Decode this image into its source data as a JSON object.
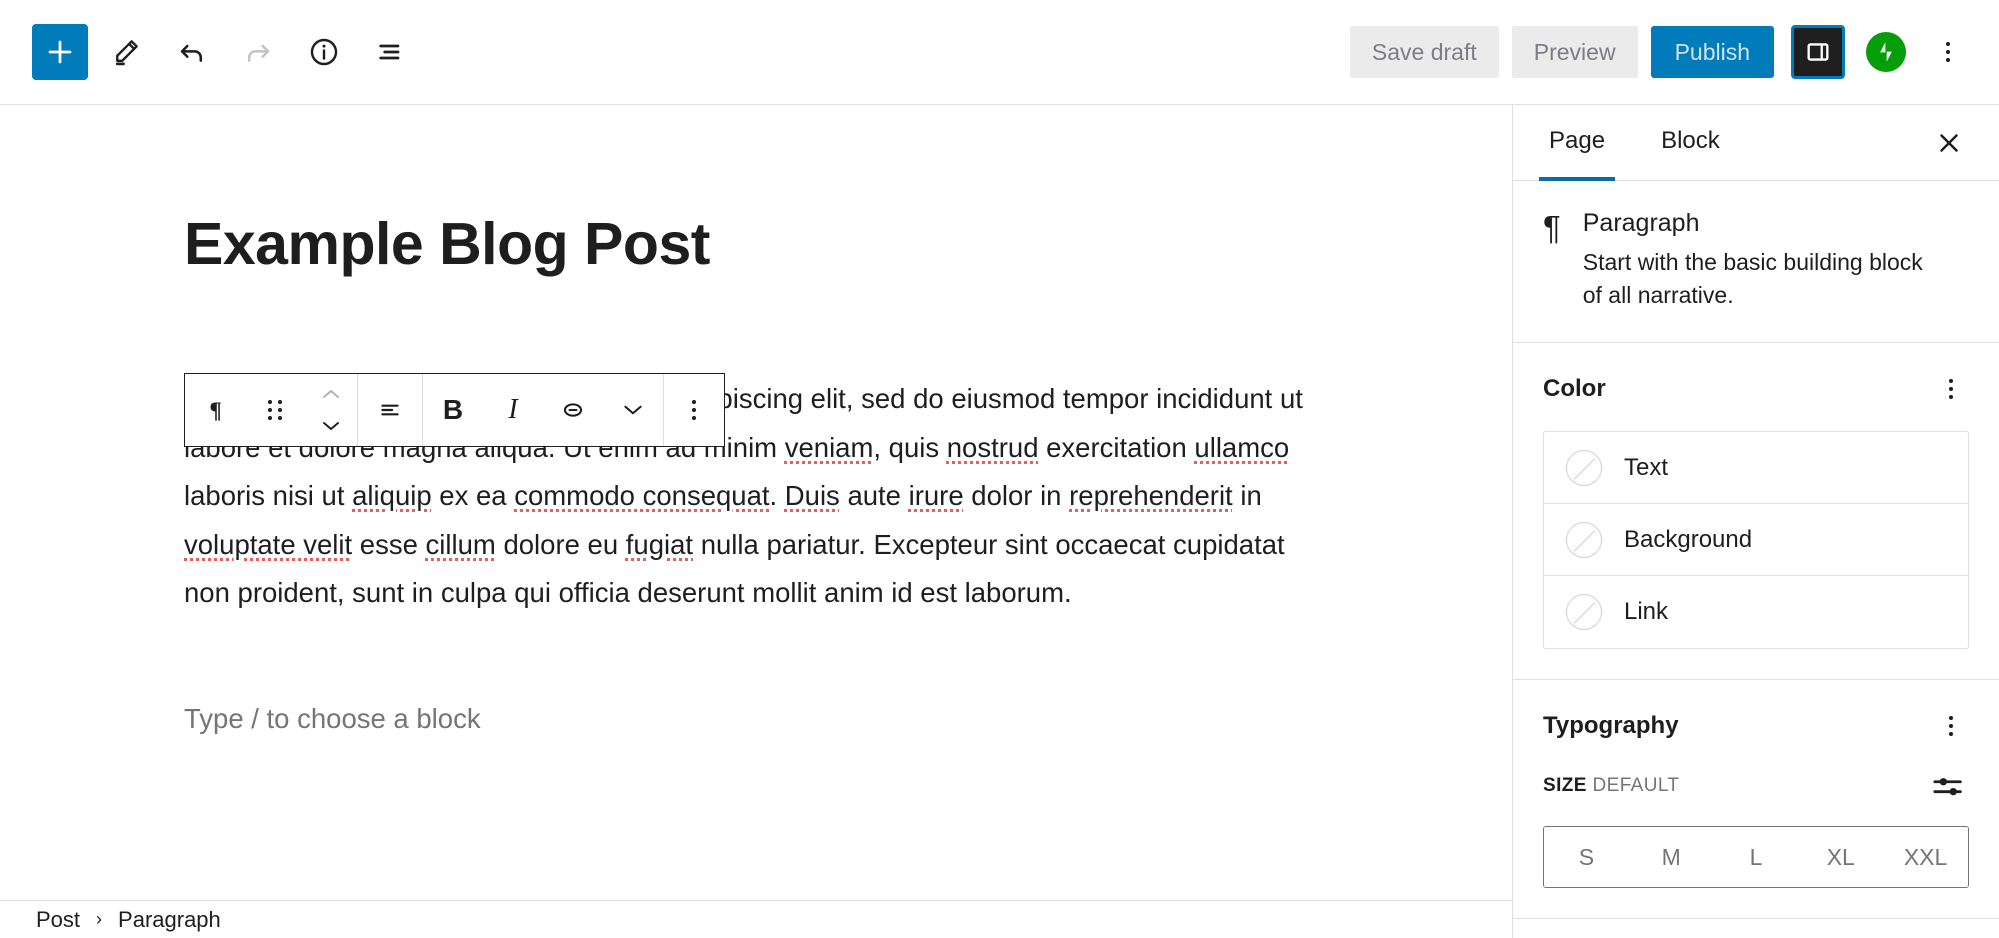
{
  "header": {
    "left_tools": [
      {
        "name": "add-block",
        "icon": "plus-icon",
        "label": "Add block"
      },
      {
        "name": "edit-mode",
        "icon": "pencil-icon",
        "label": "Tools"
      },
      {
        "name": "undo",
        "icon": "undo-icon",
        "label": "Undo"
      },
      {
        "name": "redo",
        "icon": "redo-icon",
        "label": "Redo"
      },
      {
        "name": "details",
        "icon": "info-icon",
        "label": "Details"
      },
      {
        "name": "list-view",
        "icon": "list-view-icon",
        "label": "List view"
      }
    ],
    "save_draft_label": "Save draft",
    "preview_label": "Preview",
    "publish_label": "Publish",
    "sidebar_toggle_label": "Settings",
    "jetpack_label": "Jetpack",
    "options_label": "Options",
    "accent_blue": "#007cba",
    "jetpack_green": "#069e08"
  },
  "block_toolbar": {
    "block_type_icon": "paragraph-icon",
    "drag_handle_label": "Drag",
    "move_up_label": "Move up",
    "move_down_label": "Move down",
    "align_label": "Align text",
    "bold_label": "B",
    "italic_label": "I",
    "link_label": "Link",
    "more_rich_text_label": "More",
    "options_label": "Options"
  },
  "editor": {
    "title": "Example Blog Post",
    "paragraph_segments": [
      {
        "text": "Lorem ipsum dolor sit amet, consectetur adipiscing elit, sed do eiusmod tempor incididunt ut labore et dolore magna aliqua. Ut enim ad minim ",
        "misspelled": false
      },
      {
        "text": "veniam",
        "misspelled": true
      },
      {
        "text": ", quis ",
        "misspelled": false
      },
      {
        "text": "nostrud",
        "misspelled": true
      },
      {
        "text": " exercitation ",
        "misspelled": false
      },
      {
        "text": "ullamco",
        "misspelled": true
      },
      {
        "text": " laboris nisi ut ",
        "misspelled": false
      },
      {
        "text": "aliquip",
        "misspelled": true
      },
      {
        "text": " ex ea ",
        "misspelled": false
      },
      {
        "text": "commodo consequat",
        "misspelled": true
      },
      {
        "text": ". ",
        "misspelled": false
      },
      {
        "text": "Duis",
        "misspelled": true
      },
      {
        "text": " aute ",
        "misspelled": false
      },
      {
        "text": "irure",
        "misspelled": true
      },
      {
        "text": " dolor in ",
        "misspelled": false
      },
      {
        "text": "reprehenderit",
        "misspelled": true
      },
      {
        "text": " in ",
        "misspelled": false
      },
      {
        "text": "voluptate velit",
        "misspelled": true
      },
      {
        "text": " esse ",
        "misspelled": false
      },
      {
        "text": "cillum",
        "misspelled": true
      },
      {
        "text": " dolore eu ",
        "misspelled": false
      },
      {
        "text": "fugiat",
        "misspelled": true
      },
      {
        "text": " nulla pariatur. Excepteur sint occaecat cupidatat non proident, sunt in culpa qui officia deserunt mollit anim id est laborum.",
        "misspelled": false
      }
    ],
    "empty_block_placeholder": "Type / to choose a block"
  },
  "sidebar": {
    "tabs": [
      {
        "label": "Page",
        "active": true
      },
      {
        "label": "Block",
        "active": false
      }
    ],
    "close_label": "Close settings",
    "block_card": {
      "icon": "paragraph-icon",
      "title": "Paragraph",
      "description": "Start with the basic building block of all narrative."
    },
    "color": {
      "section_title": "Color",
      "options_label": "Color options",
      "rows": [
        {
          "label": "Text"
        },
        {
          "label": "Background"
        },
        {
          "label": "Link"
        }
      ]
    },
    "typography": {
      "section_title": "Typography",
      "options_label": "Typography options",
      "size_label": "SIZE",
      "size_value": "DEFAULT",
      "custom_size_label": "Set custom size",
      "sizes": [
        "S",
        "M",
        "L",
        "XL",
        "XXL"
      ]
    }
  },
  "footer": {
    "breadcrumb": [
      {
        "label": "Post"
      },
      {
        "label": "Paragraph"
      }
    ],
    "separator": "›"
  }
}
